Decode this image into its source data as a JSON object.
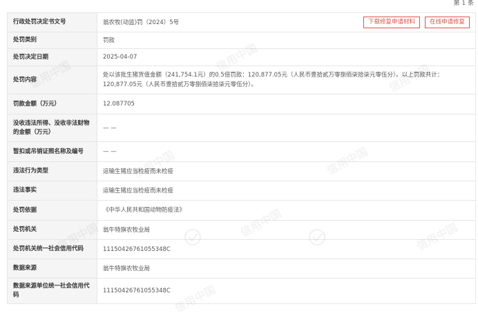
{
  "pager": {
    "text": "第 1 条"
  },
  "header": {
    "label": "行政处罚决定书文号",
    "value": "翁农牧(动监)罚（2024）5号",
    "download_button": "下载修复申请材料",
    "apply_button": "在线申请修复"
  },
  "rows": [
    {
      "label": "处罚类别",
      "value": "罚款"
    },
    {
      "label": "处罚决定日期",
      "value": "2025-04-07"
    },
    {
      "label": "处罚内容",
      "value": "处以该批生猪货值金额（241,754.1元）的0.5倍罚款：120,877.05元（人民币壹拾贰万零捌佰柒拾柒元零伍分）。以上罚款共计：120,877.05元（人民币壹拾贰万零捌佰柒拾柒元零伍分）。"
    },
    {
      "label": "罚款金额（万元）",
      "value": "12.087705"
    },
    {
      "label": "没收违法所得、没收非法财物的金额（万元）",
      "value": "— —"
    },
    {
      "label": "暂扣或吊销证照名称及编号",
      "value": "— —"
    },
    {
      "label": "违法行为类型",
      "value": "运输生猪应当检疫而未检疫"
    },
    {
      "label": "违法事实",
      "value": "运输生猪应当检疫而未检疫"
    },
    {
      "label": "处罚依据",
      "value": "《中华人民共和国动物防疫法》"
    },
    {
      "label": "处罚机关",
      "value": "翁牛特旗农牧业局"
    },
    {
      "label": "处罚机关统一社会信用代码",
      "value": "11150426761055348C"
    },
    {
      "label": "数据来源",
      "value": "翁牛特旗农牧业局"
    },
    {
      "label": "数据来源单位统一社会信用代码",
      "value": "11150426761055348C"
    }
  ],
  "watermark": {
    "text": "信用中国",
    "icon": "credit-china-logo-icon",
    "color": "#000000"
  },
  "colors": {
    "accent": "#d9534f",
    "label_bg": "#f5f5f5",
    "border": "#e6e6e6"
  }
}
